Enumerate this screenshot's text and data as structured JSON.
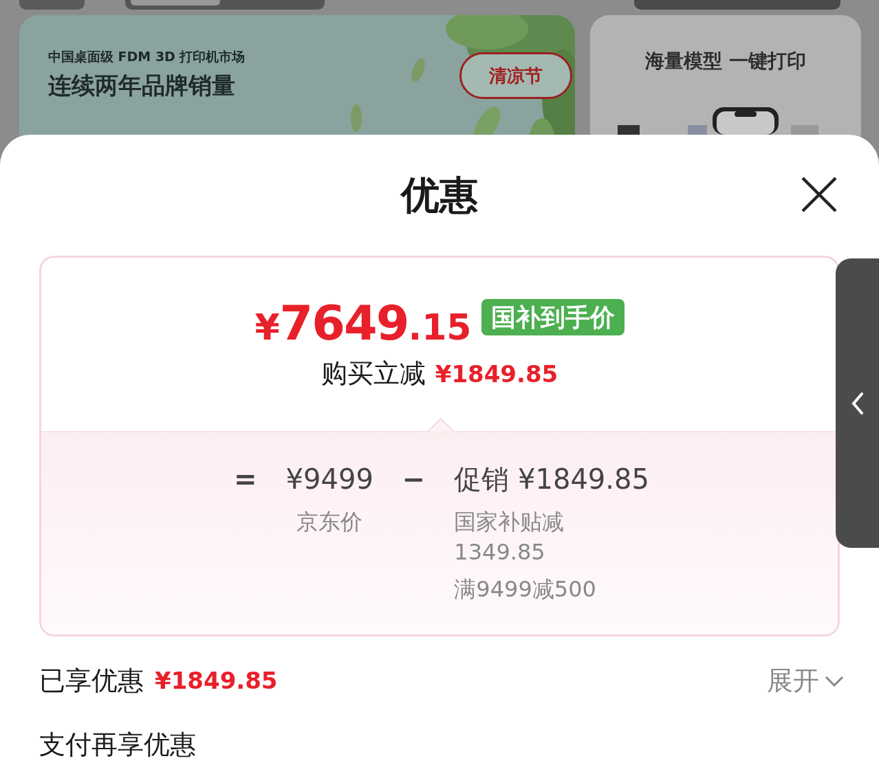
{
  "background": {
    "banner": {
      "subtitle": "中国桌面级 FDM 3D 打印机市场",
      "headline": "连续两年品牌销量",
      "stamp": "清凉节"
    },
    "side_card": {
      "title": "海量模型 一键打印"
    }
  },
  "sheet": {
    "title": "优惠",
    "price": {
      "currency": "¥",
      "integer": "7649",
      "decimal": ".15",
      "badge": "国补到手价"
    },
    "instant_discount": {
      "label": "购买立减",
      "amount": "¥1849.85"
    },
    "formula": [
      {
        "kind": "operator",
        "text": "="
      },
      {
        "kind": "term",
        "text": "¥9499",
        "notes": [
          "京东价"
        ]
      },
      {
        "kind": "operator",
        "text": "−"
      },
      {
        "kind": "term",
        "text": "促销 ¥1849.85",
        "notes": [
          "国家补贴减\n1349.85",
          "满9499减500"
        ]
      }
    ],
    "enjoyed": {
      "label": "已享优惠",
      "amount": "¥1849.85",
      "toggle": "展开"
    },
    "pay_more": "支付再享优惠"
  }
}
